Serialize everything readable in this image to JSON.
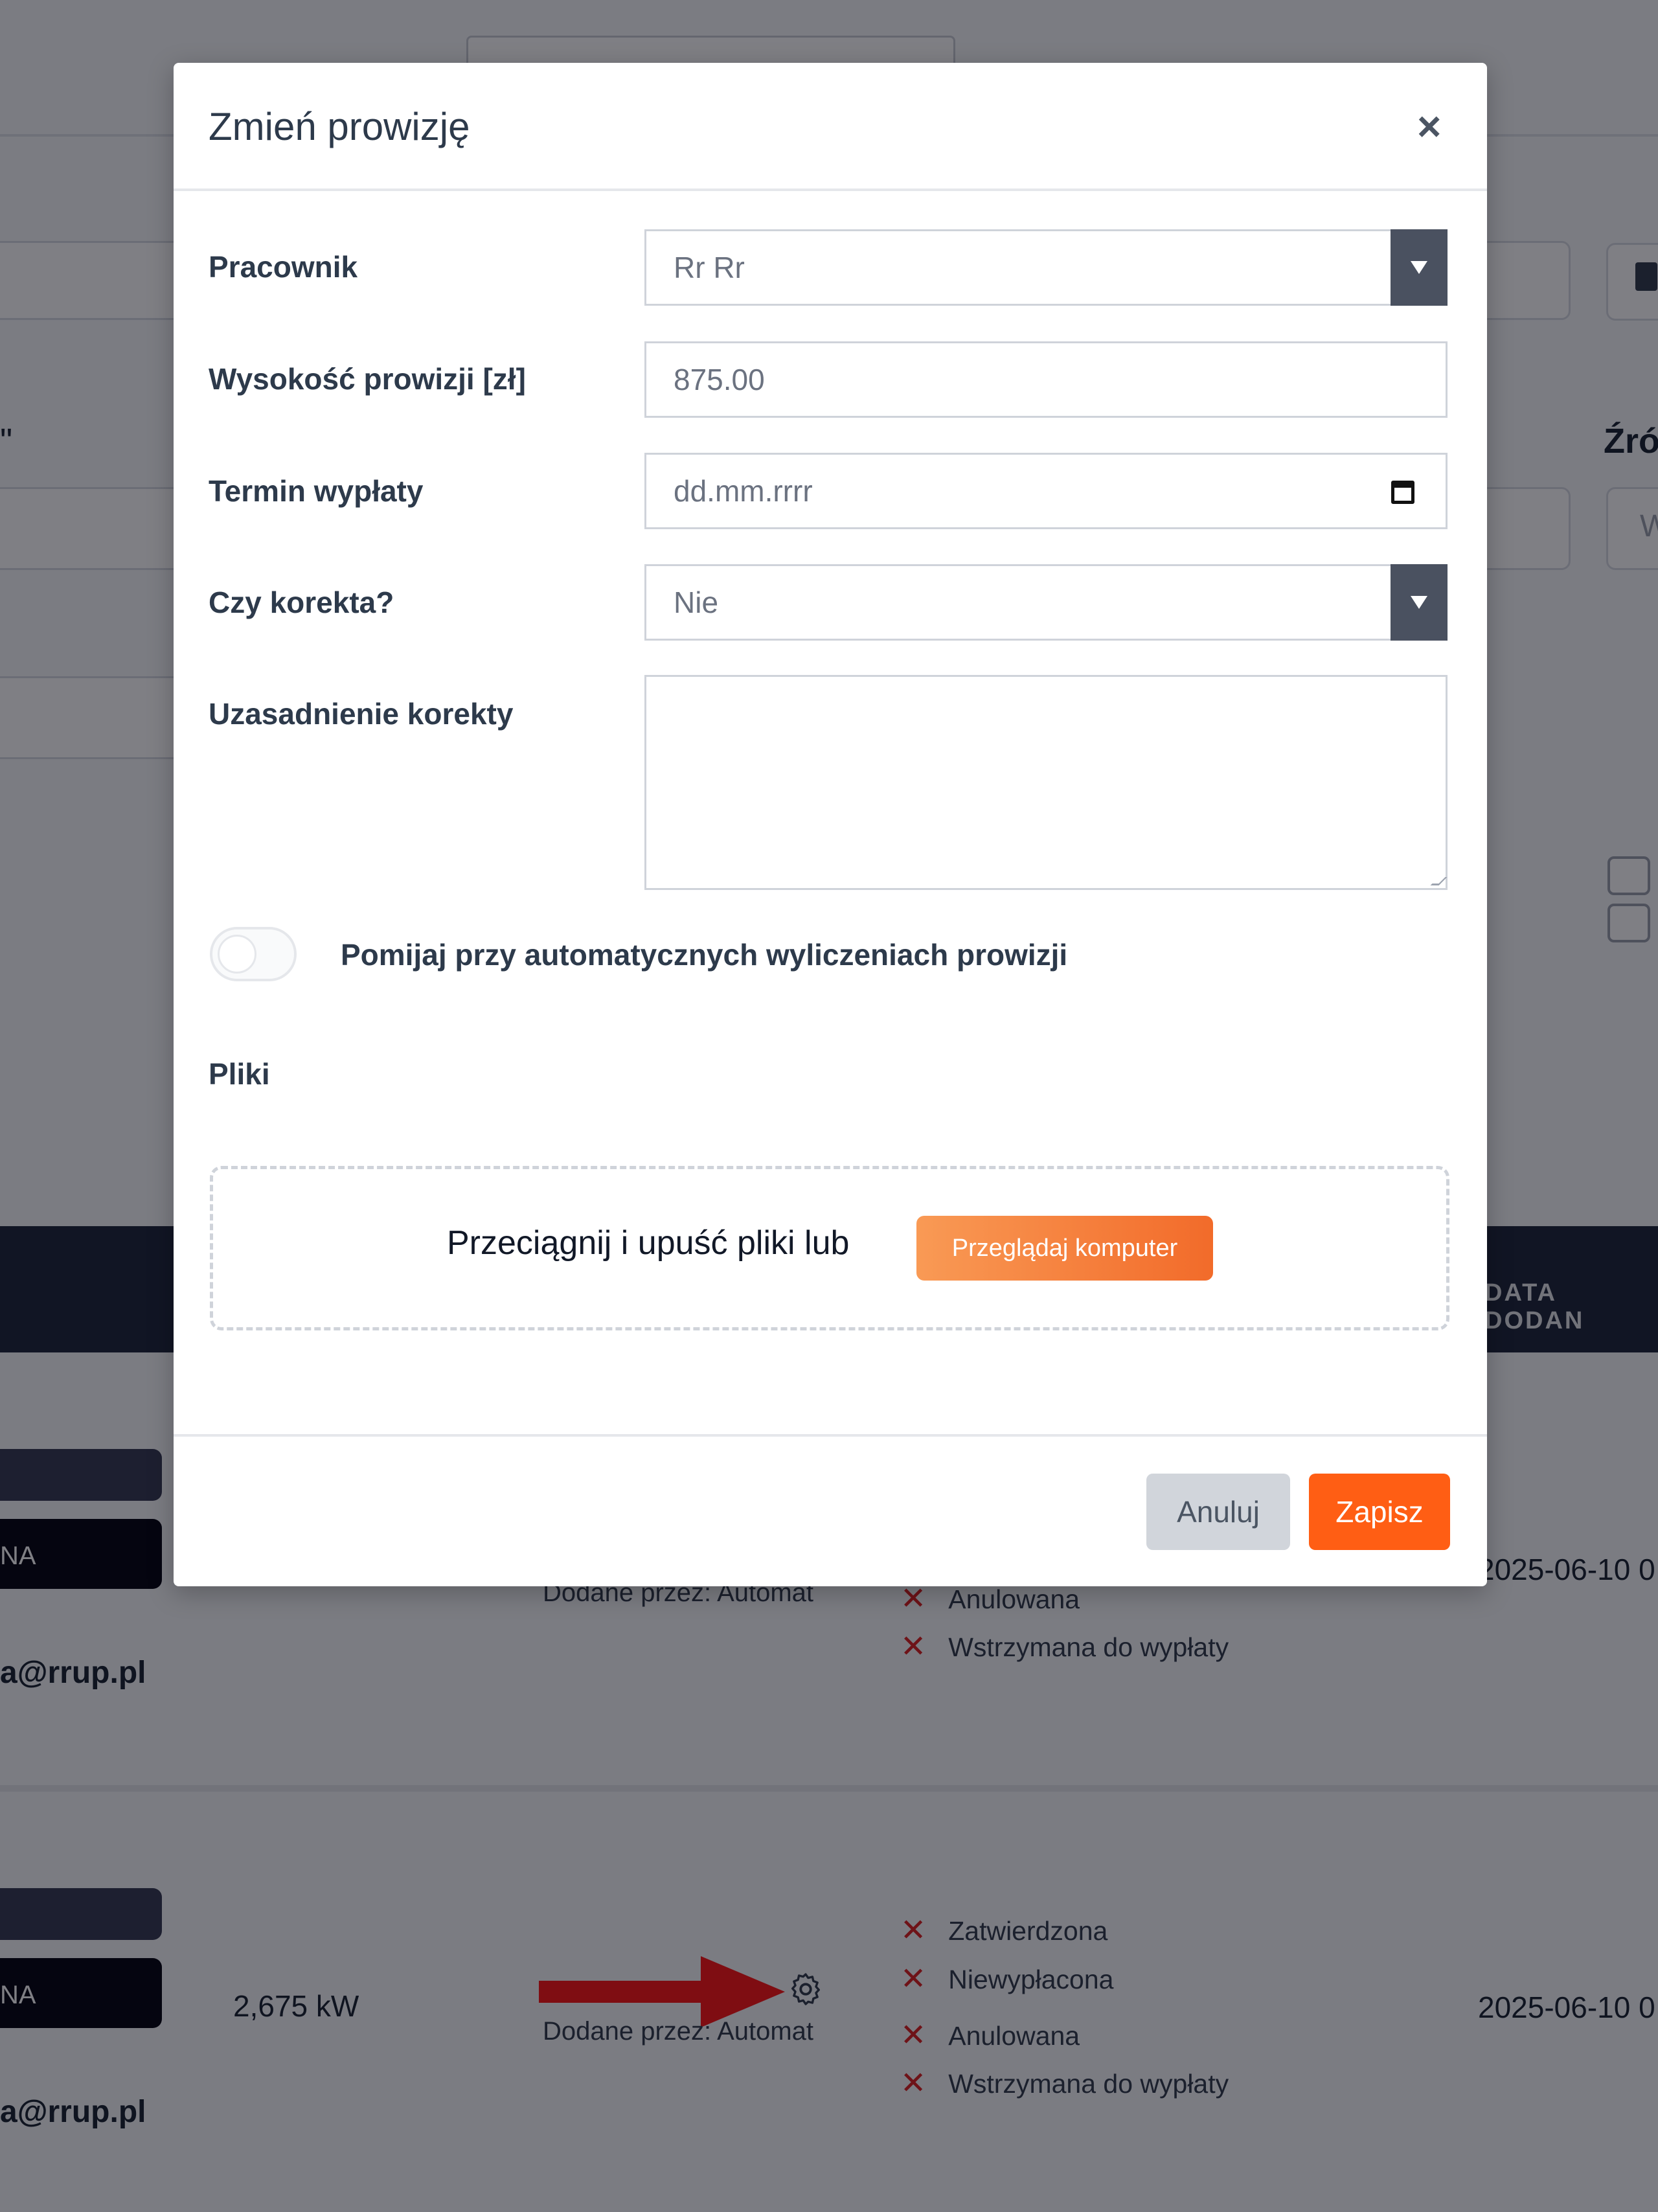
{
  "modal": {
    "title": "Zmień prowizję",
    "close_symbol": "×",
    "fields": {
      "employee_label": "Pracownik",
      "employee_value": "Rr Rr",
      "amount_label": "Wysokość prowizji [zł]",
      "amount_value": "875.00",
      "payout_date_label": "Termin wypłaty",
      "payout_date_placeholder": "dd.mm.rrrr",
      "correction_label": "Czy korekta?",
      "correction_value": "Nie",
      "correction_reason_label": "Uzasadnienie korekty",
      "correction_reason_value": ""
    },
    "toggle_label": "Pomijaj przy automatycznych wyliczeniach prowizji",
    "toggle_on": false,
    "files_label": "Pliki",
    "dropzone_text": "Przeciągnij i upuść pliki lub",
    "browse_button": "Przeglądaj komputer",
    "cancel_button": "Anuluj",
    "save_button": "Zapisz"
  },
  "background": {
    "right_header_label": "Źró",
    "right_input_placeholder": "W",
    "quote_mark": "\"",
    "table_header_label": "DATA DODAN",
    "rows": [
      {
        "pill_text": "NA",
        "email": "a@rrup.pl",
        "added_by": "Dodane przez: Automat",
        "statuses": [
          "Anulowana",
          "Wstrzymana do wypłaty"
        ],
        "date": "2025-06-10 0"
      },
      {
        "pill_text": "NA",
        "email": "a@rrup.pl",
        "power": "2,675 kW",
        "added_by": "Dodane przez: Automat",
        "statuses": [
          "Zatwierdzona",
          "Niewypłacona",
          "Anulowana",
          "Wstrzymana do wypłaty"
        ],
        "date": "2025-06-10 0"
      }
    ]
  },
  "colors": {
    "accent": "#ff5e14",
    "browse_gradient_start": "#f99a55",
    "browse_gradient_end": "#f26b2a",
    "status_x": "#dc2626",
    "arrow": "#ff1a1a",
    "table_header": "#232a3e"
  },
  "icons": {
    "close": "close-icon",
    "select_caret": "caret-down-icon",
    "calendar": "calendar-icon",
    "status_x": "x-mark-icon",
    "gear": "gear-icon",
    "arrow": "red-arrow-icon"
  }
}
